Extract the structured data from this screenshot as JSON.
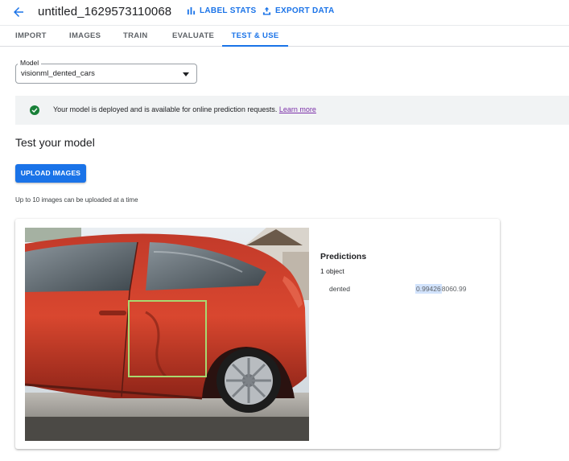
{
  "header": {
    "title": "untitled_1629573110068",
    "label_stats": "LABEL STATS",
    "export_data": "EXPORT DATA"
  },
  "tabs": [
    {
      "label": "IMPORT"
    },
    {
      "label": "IMAGES"
    },
    {
      "label": "TRAIN"
    },
    {
      "label": "EVALUATE"
    },
    {
      "label": "TEST & USE"
    }
  ],
  "model": {
    "label": "Model",
    "value": "visionml_dented_cars"
  },
  "banner": {
    "text": "Your model is deployed and is available for online prediction requests.",
    "link": "Learn more"
  },
  "test": {
    "heading": "Test your model",
    "upload_label": "UPLOAD IMAGES",
    "hint": "Up to 10 images can be uploaded at a time"
  },
  "predictions": {
    "title": "Predictions",
    "count": "1 object",
    "items": [
      {
        "label": "dented",
        "score_highlight": "0.99426",
        "score_rest": "8060.99"
      }
    ]
  },
  "colors": {
    "accent": "#1a73e8",
    "success": "#188038",
    "bbox": "#a8d870"
  }
}
